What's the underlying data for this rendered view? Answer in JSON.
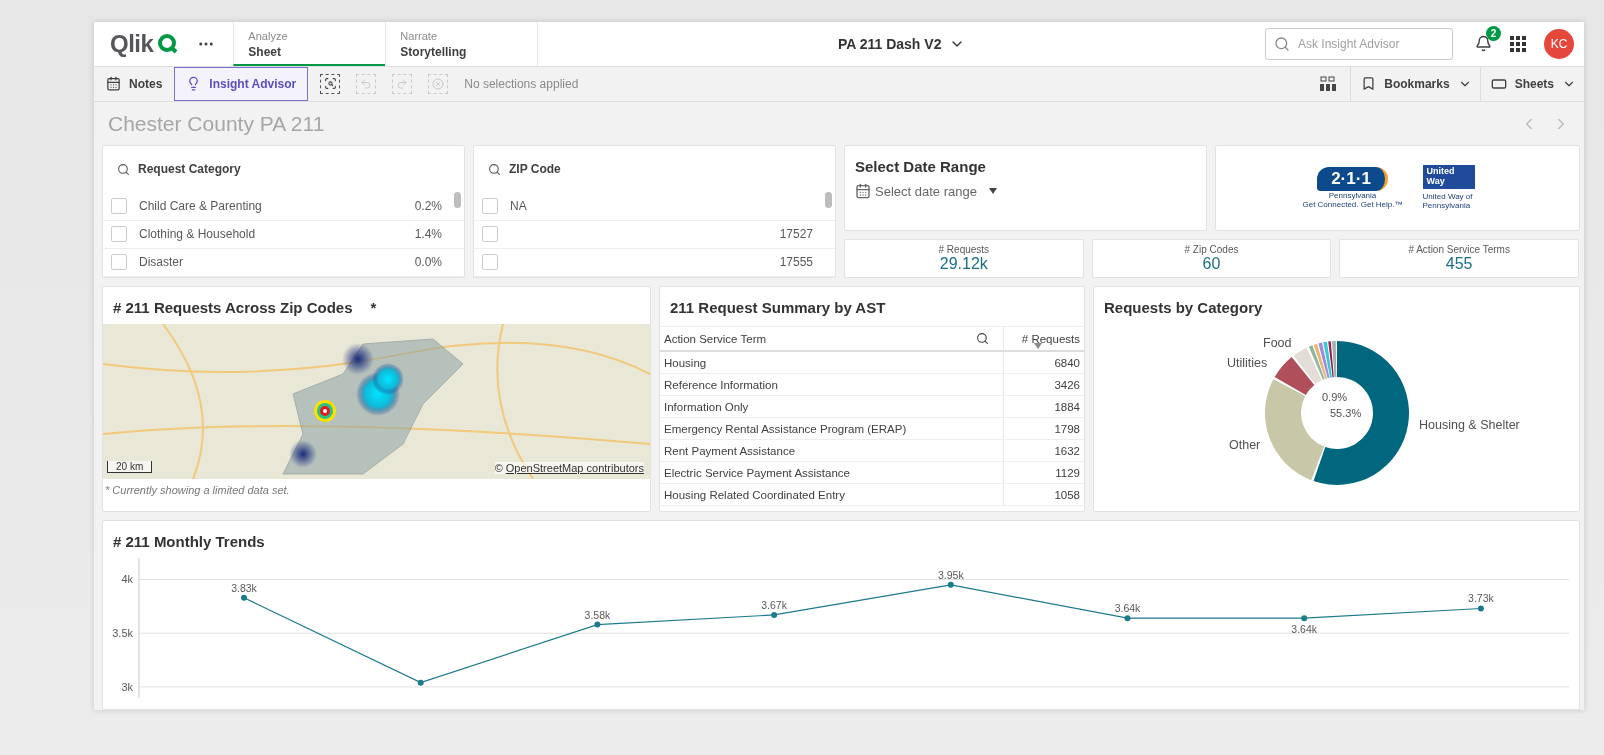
{
  "app_bar": {
    "logo": "Qlik",
    "tabs": [
      {
        "overline": "Analyze",
        "label": "Sheet",
        "selected": true
      },
      {
        "overline": "Narrate",
        "label": "Storytelling",
        "selected": false
      }
    ],
    "app_title": "PA 211 Dash V2",
    "search": {
      "placeholder": "Ask Insight Advisor"
    },
    "notification_count": "2",
    "avatar": "KC"
  },
  "toolbar": {
    "tools": [
      {
        "kind": "notes",
        "label": "Notes",
        "selected": false
      },
      {
        "kind": "insight",
        "label": "Insight Advisor",
        "selected": true
      }
    ],
    "selection_actions": [
      {
        "kind": "search",
        "disabled": false
      },
      {
        "kind": "back",
        "disabled": true
      },
      {
        "kind": "forward",
        "disabled": true
      },
      {
        "kind": "clear",
        "disabled": true
      }
    ],
    "selection_status": "No selections applied",
    "menus": [
      {
        "kind": "bookmarks",
        "label": "Bookmarks"
      },
      {
        "kind": "sheets",
        "label": "Sheets"
      }
    ]
  },
  "sheet": {
    "title": "Chester County PA 211"
  },
  "filters": [
    {
      "title": "Request Category",
      "items": [
        {
          "label": "Child Care & Parenting",
          "value": "0.2%",
          "checked": false
        },
        {
          "label": "Clothing & Household",
          "value": "1.4%",
          "checked": false
        },
        {
          "label": "Disaster",
          "value": "0.0%",
          "checked": false
        }
      ]
    },
    {
      "title": "ZIP Code",
      "items": [
        {
          "label": "NA",
          "checked": false
        },
        {
          "value": "17527",
          "checked": false
        },
        {
          "value": "17555",
          "checked": false
        }
      ]
    }
  ],
  "date_range": {
    "title": "Select Date Range",
    "label": "Select date range"
  },
  "logos": {
    "badge": "2·1·1",
    "badge_state": "Pennsylvania",
    "badge_tagline": "Get Connected. Get Help.™",
    "partner": "United Way",
    "partner_caption": "United Way of Pennsylvania"
  },
  "kpis": [
    {
      "label": "# Requests",
      "value": "29.12k"
    },
    {
      "label": "# Zip Codes",
      "value": "60"
    },
    {
      "label": "# Action Service Terms",
      "value": "455"
    }
  ],
  "map": {
    "title": "# 211 Requests Across Zip Codes",
    "marker": "*",
    "scale": "20 km",
    "attribution_prefix": "©",
    "attribution_link": "OpenStreetMap contributors",
    "footnote": "* Currently showing a limited data set."
  },
  "summary_table": {
    "title": "211 Request Summary by AST",
    "columns": [
      "Action Service Term",
      "# Requests"
    ],
    "rows": [
      [
        "Housing",
        "6840"
      ],
      [
        "Reference Information",
        "3426"
      ],
      [
        "Information Only",
        "1884"
      ],
      [
        "Emergency Rental Assistance Program (ERAP)",
        "1798"
      ],
      [
        "Rent Payment Assistance",
        "1632"
      ],
      [
        "Electric Service Payment Assistance",
        "1129"
      ],
      [
        "Housing Related Coordinated Entry",
        "1058"
      ]
    ]
  },
  "category_donut": {
    "title": "Requests by Category",
    "labels": [
      "Food",
      "Utilities",
      "Other",
      "Housing & Shelter"
    ],
    "center_labels": [
      "0.9%",
      "55.3%"
    ]
  },
  "monthly_trends": {
    "chart_data": {
      "type": "line",
      "title": "# 211 Monthly Trends",
      "ylim": [
        2990,
        4200
      ],
      "yticks": [
        {
          "value": 3000,
          "label": "3k"
        },
        {
          "value": 3500,
          "label": "3.5k"
        },
        {
          "value": 4000,
          "label": "4k"
        }
      ],
      "series": [
        {
          "color": "#1c7a8c",
          "marker": true,
          "values": [
            3830,
            3040,
            3580,
            3670,
            3950,
            3640,
            3640,
            3730
          ]
        }
      ],
      "value_labels": [
        "3.83k",
        null,
        "3.58k",
        "3.67k",
        "3.95k",
        "3.64k",
        "3.64k",
        "3.73k"
      ]
    }
  }
}
